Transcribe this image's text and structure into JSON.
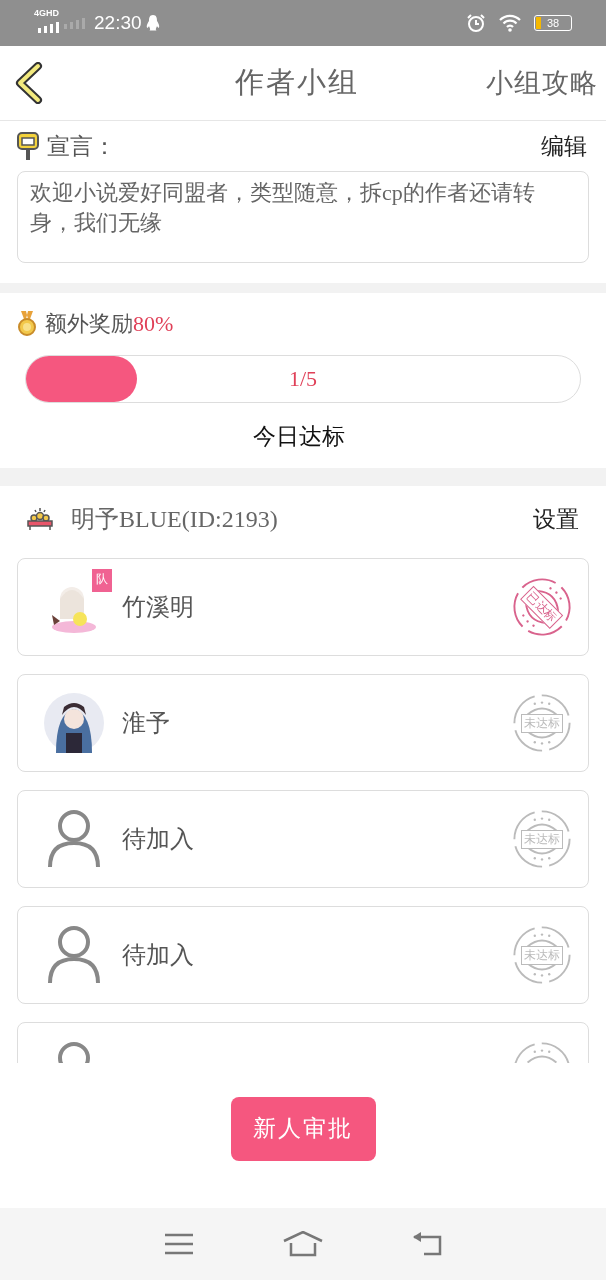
{
  "status_bar": {
    "network": "4GHD",
    "time": "22:30",
    "battery": "38"
  },
  "header": {
    "title": "作者小组",
    "action": "小组攻略"
  },
  "declaration": {
    "label": "宣言：",
    "edit": "编辑",
    "text": "欢迎小说爱好同盟者，类型随意，拆cp的作者还请转身，我们无缘"
  },
  "bonus": {
    "label": "额外奖励",
    "value": "80%",
    "level": 0.2,
    "progress": "1/5",
    "caption": "今日达标"
  },
  "group": {
    "name": "明予BLUE(ID:2193)",
    "settings": "设置"
  },
  "members": [
    {
      "kind": "member",
      "name": "竹溪明",
      "badge": "队",
      "achieved": true,
      "stamp": "已达标"
    },
    {
      "kind": "member",
      "name": "淮予",
      "achieved": false,
      "stamp": "未达标"
    },
    {
      "kind": "vacant",
      "name": "待加入",
      "achieved": false,
      "stamp": "未达标"
    },
    {
      "kind": "vacant",
      "name": "待加入",
      "achieved": false,
      "stamp": "未达标"
    },
    {
      "kind": "vacant",
      "achieved": false
    }
  ],
  "approve_button": "新人审批"
}
